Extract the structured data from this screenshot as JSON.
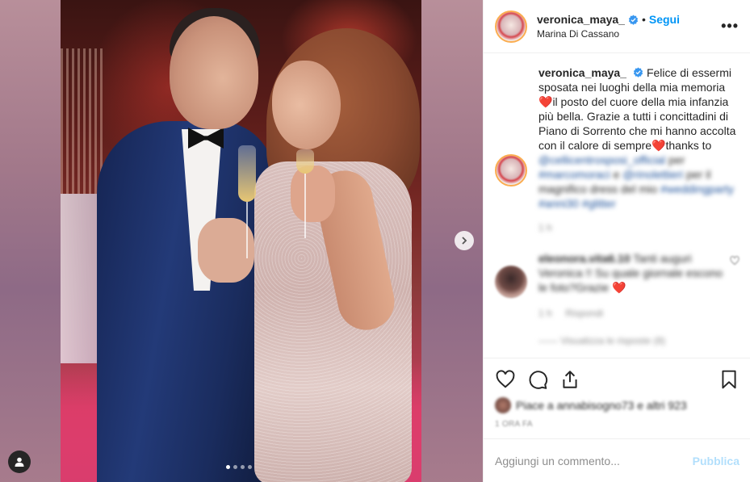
{
  "post": {
    "username": "veronica_maya_",
    "follow_label": "Segui",
    "separator": "•",
    "location": "Marina Di Cassano",
    "more_label": "•••",
    "carousel": {
      "slide_count": 4,
      "active_index": 0
    }
  },
  "caption": {
    "username": "veronica_maya_",
    "text_1": "Felice di essermi sposata nei luoghi della mia memoria",
    "heart": "❤️",
    "text_2": "il posto del cuore della mia infanzia più bella. Grazie a tutti i concittadini di Piano di Sorrento che mi hanno accolta con il calore di sempre",
    "text_3": "thanks to",
    "mention_1": "@cellicentrosposi_official",
    "text_per": "per",
    "mention_2": "#marcomoraci",
    "text_e": "e",
    "mention_3": "@rinolettieri",
    "text_4": "per il magnifico dress del mio",
    "hashtags": "#weddingparty #anni30 #glitter",
    "time": "1 h"
  },
  "comment": {
    "username": "eleonora.vita6.10",
    "text": "Tanti auguri Veronica !! Su quale giornale escono le foto?Grazie",
    "heart": "❤️",
    "time": "1 h",
    "reply_label": "Rispondi",
    "view_replies": "—— Visualizza le risposte (8)"
  },
  "actions": {
    "likes_text": "Piace a annabisogno73 e altri 923",
    "posted": "1 ORA FA"
  },
  "add_comment": {
    "placeholder": "Aggiungi un commento...",
    "publish_label": "Pubblica"
  },
  "colors": {
    "link": "#0095f6",
    "publish_disabled": "#b2dffc",
    "heart": "#ed4956",
    "text": "#262626",
    "muted": "#8e8e8e"
  }
}
